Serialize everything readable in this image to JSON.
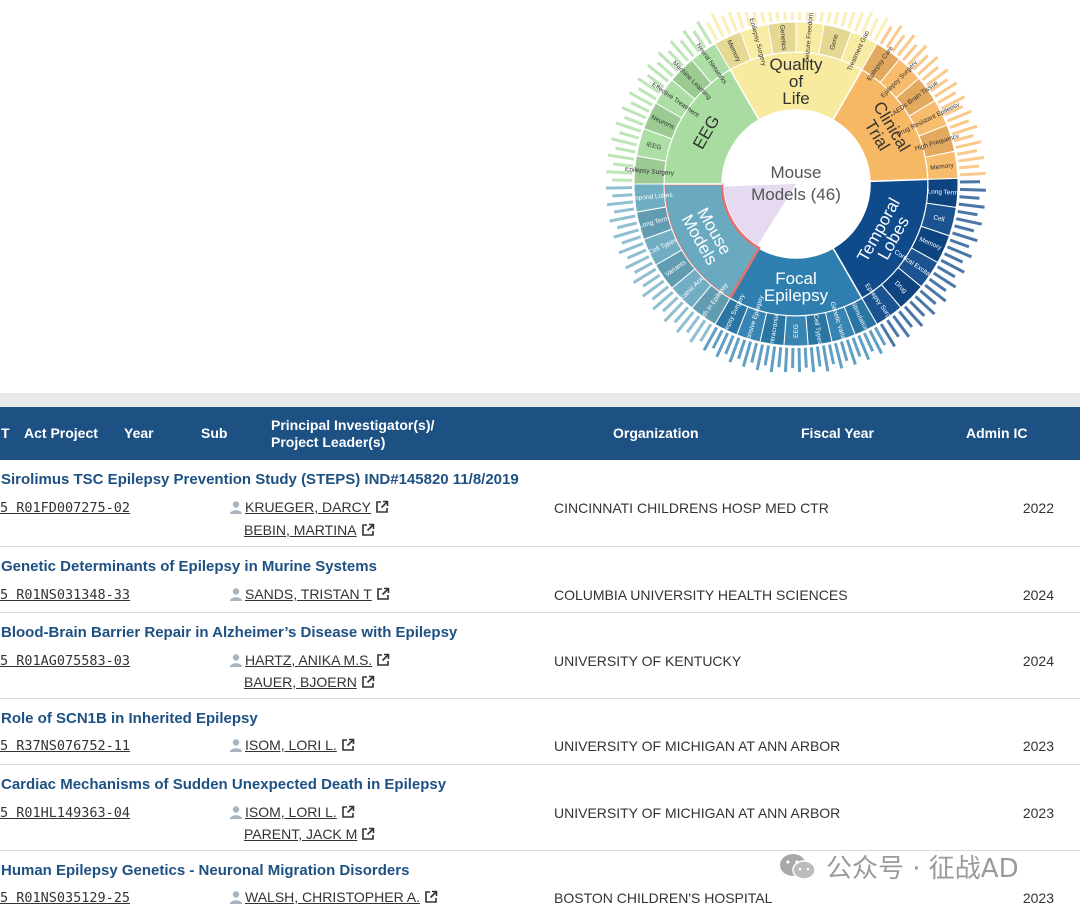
{
  "chart_data": {
    "type": "sunburst",
    "center_label": "Mouse Models (46)",
    "inner_ring": [
      {
        "name": "Quality of Life",
        "color": "#f8eba0"
      },
      {
        "name": "Clinical Trial",
        "color": "#f7b866"
      },
      {
        "name": "Temporal Lobes",
        "color": "#0f4a8a"
      },
      {
        "name": "Focal Epilepsy",
        "color": "#2e7fb0"
      },
      {
        "name": "Mouse Models",
        "color": "#6aaac0",
        "selected": true
      },
      {
        "name": "EEG",
        "color": "#a8dca0"
      }
    ],
    "outer_ring": {
      "Quality of Life": [
        "Memory",
        "Epilepsy Surgery",
        "Genetics",
        "Seizure Freedom",
        "Gene",
        "Treatment Gap"
      ],
      "Clinical Trial": [
        "Epilepsy Care",
        "Epilepsy Surgery",
        "AEDs Brain Tissue",
        "Drug Resistant Epilepsy",
        "High Frequency",
        "Memory"
      ],
      "Temporal Lobes": [
        "Long Term",
        "Cell",
        "Memory",
        "Cortical Excitability",
        "Drug",
        "Epilepsy Surgery"
      ],
      "Focal Epilepsy": [
        "Stimulation",
        "Genetic Variants",
        "Cell Types",
        "EEG",
        "Intracranial",
        "Responsive Epilepsy",
        "Epilepsy Surgery"
      ],
      "Mouse Models": [
        "Death in Epilepsy",
        "Kainic Acid",
        "Variants",
        "Cell Types",
        "Long Term",
        "Temporal Lobes"
      ],
      "EEG": [
        "Epilepsy Surgery",
        "iEEG",
        "Neurons",
        "Effective Treatment",
        "Machine Learning",
        "Neural Networks"
      ]
    }
  },
  "table": {
    "headers": {
      "type": "T",
      "act_project": "Act Project",
      "year": "Year",
      "sub": "Sub",
      "pi_line1": "Principal Investigator(s)/",
      "pi_line2": "Project Leader(s)",
      "organization": "Organization",
      "fiscal_year": "Fiscal Year",
      "admin_ic": "Admin IC"
    },
    "rows": [
      {
        "title": "Sirolimus TSC Epilepsy Prevention Study (STEPS) IND#145820 11/8/2019",
        "project": "5 R01FD007275-02",
        "pis": [
          "KRUEGER, DARCY",
          "BEBIN, MARTINA"
        ],
        "org": "CINCINNATI CHILDRENS HOSP MED CTR",
        "fy": "2022"
      },
      {
        "title": "Genetic Determinants of Epilepsy in Murine Systems",
        "project": "5 R01NS031348-33",
        "pis": [
          "SANDS, TRISTAN T"
        ],
        "org": "COLUMBIA UNIVERSITY HEALTH SCIENCES",
        "fy": "2024"
      },
      {
        "title": "Blood-Brain Barrier Repair in Alzheimer’s Disease with Epilepsy",
        "project": "5 R01AG075583-03",
        "pis": [
          "HARTZ, ANIKA M.S.",
          "BAUER, BJOERN"
        ],
        "org": "UNIVERSITY OF KENTUCKY",
        "fy": "2024"
      },
      {
        "title": "Role of SCN1B in Inherited Epilepsy",
        "project": "5 R37NS076752-11",
        "pis": [
          "ISOM, LORI L."
        ],
        "org": "UNIVERSITY OF MICHIGAN AT ANN ARBOR",
        "fy": "2023"
      },
      {
        "title": "Cardiac Mechanisms of Sudden Unexpected Death in Epilepsy",
        "project": "5 R01HL149363-04",
        "pis": [
          "ISOM, LORI L.",
          "PARENT, JACK M"
        ],
        "org": "UNIVERSITY OF MICHIGAN AT ANN ARBOR",
        "fy": "2023"
      },
      {
        "title": "Human Epilepsy Genetics - Neuronal Migration Disorders",
        "project": "5 R01NS035129-25",
        "pis": [
          "WALSH, CHRISTOPHER A."
        ],
        "org": "BOSTON CHILDREN'S HOSPITAL",
        "fy": "2023"
      }
    ]
  },
  "watermark": "公众号 · 征战AD",
  "colors": {
    "header_bg": "#1e5183",
    "title_link": "#1e5183"
  }
}
